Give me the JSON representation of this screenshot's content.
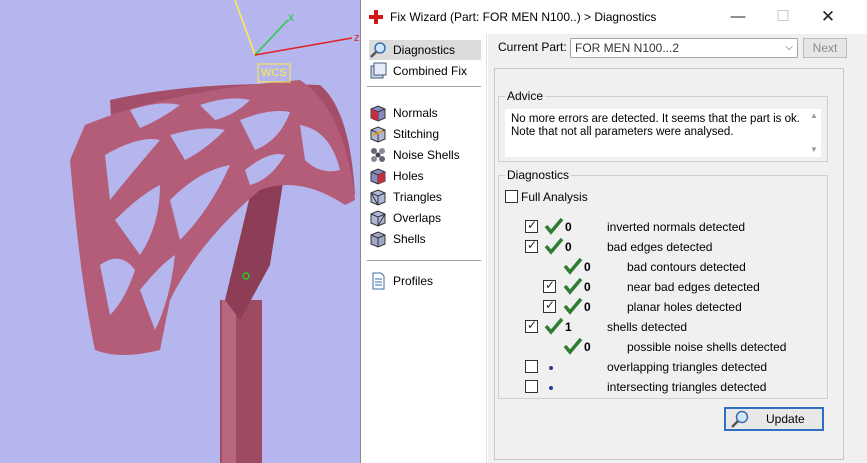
{
  "window": {
    "title": "Fix Wizard (Part: FOR MEN N100..) > Diagnostics",
    "minimize_glyph": "—",
    "maximize_glyph": "☐",
    "close_glyph": "✕"
  },
  "viewport": {
    "axis_x_label": "x",
    "axis_z_label": "z",
    "wcs_label": "WCS"
  },
  "nav": {
    "items": [
      {
        "label": "Diagnostics",
        "icon": "magnifier-icon",
        "active": true
      },
      {
        "label": "Combined Fix",
        "icon": "combined-fix-icon"
      },
      {
        "label": "Normals",
        "icon": "normals-cube-icon"
      },
      {
        "label": "Stitching",
        "icon": "stitching-cube-icon"
      },
      {
        "label": "Noise Shells",
        "icon": "noise-shells-icon"
      },
      {
        "label": "Holes",
        "icon": "holes-cube-icon"
      },
      {
        "label": "Triangles",
        "icon": "triangles-cube-icon"
      },
      {
        "label": "Overlaps",
        "icon": "overlaps-cube-icon"
      },
      {
        "label": "Shells",
        "icon": "shells-cube-icon"
      },
      {
        "label": "Profiles",
        "icon": "profiles-document-icon"
      }
    ]
  },
  "main": {
    "current_part_label": "Current Part:",
    "current_part_value": "FOR MEN N100...2",
    "next_label": "Next",
    "advice": {
      "title": "Advice",
      "text_line1": "No more errors are detected. It seems that the part is ok.",
      "text_line2": "Note that not all parameters were analysed."
    },
    "diagnostics": {
      "title": "Diagnostics",
      "full_analysis_label": "Full Analysis",
      "full_analysis_checked": false,
      "rows": [
        {
          "count": "0",
          "label": "inverted normals detected",
          "checked": true,
          "status": "ok"
        },
        {
          "count": "0",
          "label": "bad edges detected",
          "checked": true,
          "status": "ok"
        },
        {
          "count": "0",
          "label": "bad contours detected",
          "checked": null,
          "status": "ok"
        },
        {
          "count": "0",
          "label": "near bad edges detected",
          "checked": true,
          "status": "ok"
        },
        {
          "count": "0",
          "label": "planar holes detected",
          "checked": true,
          "status": "ok"
        },
        {
          "count": "1",
          "label": "shells detected",
          "checked": true,
          "status": "ok"
        },
        {
          "count": "0",
          "label": "possible noise shells detected",
          "checked": null,
          "status": "ok"
        },
        {
          "count": "",
          "label": "overlapping triangles detected",
          "checked": false,
          "status": "not-analysed"
        },
        {
          "count": "",
          "label": "intersecting triangles detected",
          "checked": false,
          "status": "not-analysed"
        }
      ]
    },
    "update_label": "Update"
  },
  "colors": {
    "ok_tick": "#2e7d32",
    "model": "#b35d78",
    "viewport_bg": "#b6b6ee",
    "update_border": "#2d6fc4"
  }
}
